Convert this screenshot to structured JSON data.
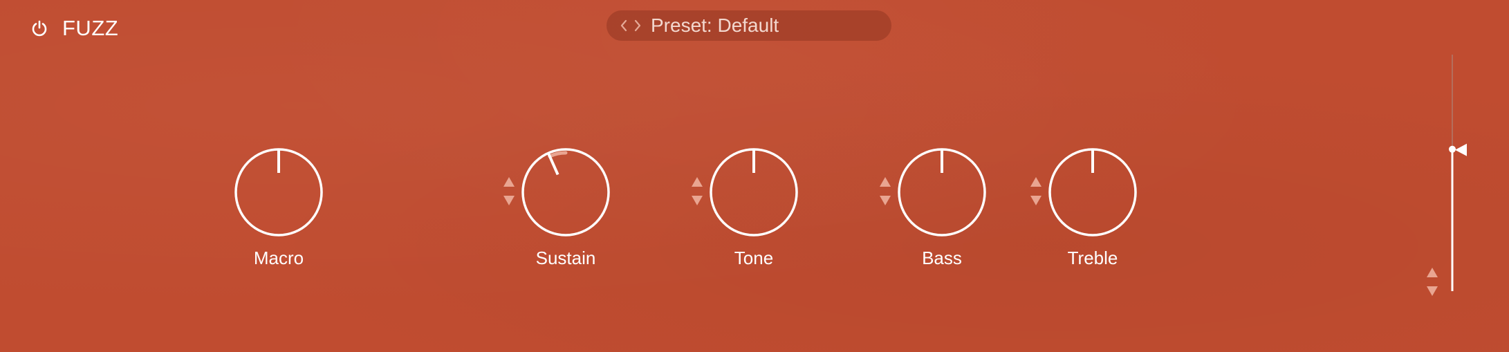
{
  "plugin": {
    "title": "FUZZ",
    "power_icon": "power-icon"
  },
  "preset": {
    "label": "Preset: Default"
  },
  "knobs": [
    {
      "id": "macro",
      "label": "Macro",
      "value": 0.5,
      "has_mod": false
    },
    {
      "id": "sustain",
      "label": "Sustain",
      "value": 0.42,
      "has_mod": true
    },
    {
      "id": "tone",
      "label": "Tone",
      "value": 0.5,
      "has_mod": true
    },
    {
      "id": "bass",
      "label": "Bass",
      "value": 0.5,
      "has_mod": true
    },
    {
      "id": "treble",
      "label": "Treble",
      "value": 0.5,
      "has_mod": true
    }
  ],
  "output_fader": {
    "value": 0.6
  },
  "colors": {
    "background": "#c04c30",
    "foreground": "#ffffff",
    "muted": "#e9a591"
  }
}
